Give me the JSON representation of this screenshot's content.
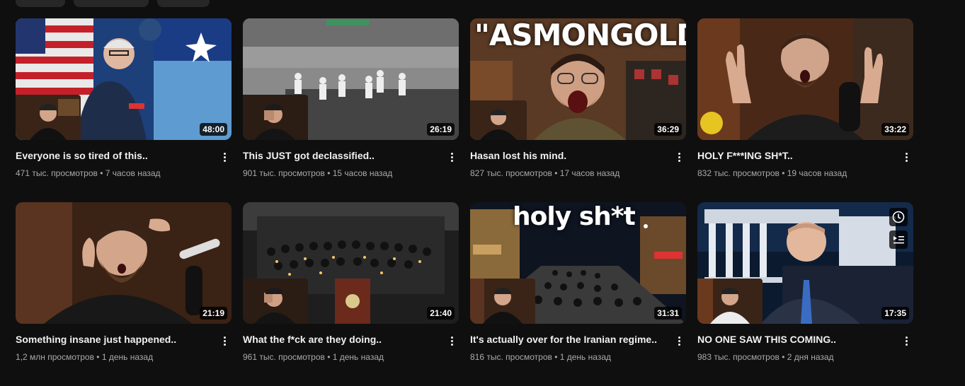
{
  "videos": [
    {
      "title": "Everyone is so tired of this..",
      "views": "471 тыс. просмотров",
      "age": "7 часов назад",
      "duration": "48:00",
      "thumb_icon": "press-conference-thumbnail"
    },
    {
      "title": "This JUST got declassified..",
      "views": "901 тыс. просмотров",
      "age": "15 часов назад",
      "duration": "26:19",
      "thumb_icon": "thermal-footage-thumbnail"
    },
    {
      "title": "Hasan lost his mind.",
      "views": "827 тыс. просмотров",
      "age": "17 часов назад",
      "duration": "36:29",
      "thumb_icon": "shouting-streamer-thumbnail",
      "overlay_text": "\"ASMONGOLD\""
    },
    {
      "title": "HOLY F***ING SH*T..",
      "views": "832 тыс. просмотров",
      "age": "19 часов назад",
      "duration": "33:22",
      "thumb_icon": "shocked-streamer-thumbnail"
    },
    {
      "title": "Something insane just happened..",
      "views": "1,2 млн просмотров",
      "age": "1 день назад",
      "duration": "21:19",
      "thumb_icon": "surprised-streamer-thumbnail"
    },
    {
      "title": "What the f*ck are they doing..",
      "views": "961 тыс. просмотров",
      "age": "1 день назад",
      "duration": "21:40",
      "thumb_icon": "candlelight-vigil-thumbnail"
    },
    {
      "title": "It's actually over for the Iranian regime..",
      "views": "816 тыс. просмотров",
      "age": "1 день назад",
      "duration": "31:31",
      "thumb_icon": "night-crowd-thumbnail",
      "overlay_text": "holy sh*t"
    },
    {
      "title": "NO ONE SAW THIS COMING..",
      "views": "983 тыс. просмотров",
      "age": "2 дня назад",
      "duration": "17:35",
      "thumb_icon": "news-anchor-thumbnail",
      "hover_icons": [
        "watch-later-icon",
        "add-to-queue-icon"
      ]
    }
  ],
  "separator": " • "
}
